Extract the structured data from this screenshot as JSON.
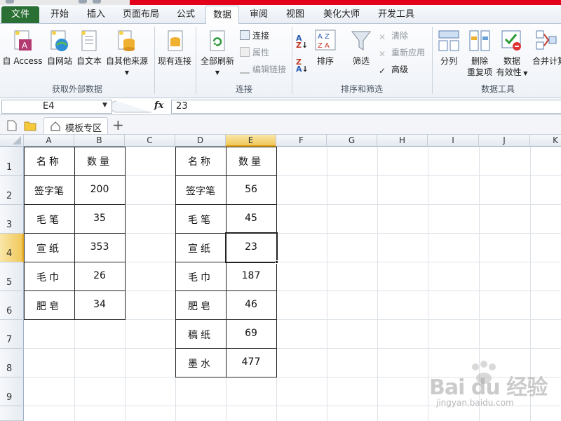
{
  "tabs": [
    {
      "label": "文件",
      "name": "tab-file"
    },
    {
      "label": "开始",
      "name": "tab-home"
    },
    {
      "label": "插入",
      "name": "tab-insert"
    },
    {
      "label": "页面布局",
      "name": "tab-page-layout"
    },
    {
      "label": "公式",
      "name": "tab-formulas"
    },
    {
      "label": "数据",
      "name": "tab-data"
    },
    {
      "label": "审阅",
      "name": "tab-review"
    },
    {
      "label": "视图",
      "name": "tab-view"
    },
    {
      "label": "美化大师",
      "name": "tab-beautify"
    },
    {
      "label": "开发工具",
      "name": "tab-developer"
    }
  ],
  "active_tab": "数据",
  "ribbon": {
    "external": {
      "label": "获取外部数据",
      "access": "自 Access",
      "web": "自网站",
      "text": "自文本",
      "other": "自其他来源",
      "existing": "现有连接"
    },
    "connections": {
      "label": "连接",
      "refresh_all": "全部刷新",
      "connections": "连接",
      "properties": "属性",
      "edit_links": "编辑链接"
    },
    "sort_filter": {
      "label": "排序和筛选",
      "sort": "排序",
      "filter": "筛选",
      "clear": "清除",
      "reapply": "重新应用",
      "advanced": "高级"
    },
    "data_tools": {
      "label": "数据工具",
      "split": "分列",
      "remove_dup_1": "删除",
      "remove_dup_2": "重复项",
      "validation_1": "数据",
      "validation_2": "有效性",
      "consolidate": "合并计算"
    }
  },
  "formula_bar": {
    "name_box": "E4",
    "fx": "fx",
    "value": "23"
  },
  "doc_tab": {
    "label": "模板专区",
    "add": "+"
  },
  "grid": {
    "columns": [
      "A",
      "B",
      "C",
      "D",
      "E",
      "F",
      "G",
      "H",
      "I",
      "J",
      "K"
    ],
    "rows": [
      "1",
      "2",
      "3",
      "4",
      "5",
      "6",
      "7",
      "8",
      "9"
    ],
    "selected_column": "E",
    "selected_row": "4"
  },
  "table1": {
    "header": [
      "名称",
      "数量"
    ],
    "rows": [
      [
        "签字笔",
        "200"
      ],
      [
        "毛笔",
        "35"
      ],
      [
        "宣纸",
        "353"
      ],
      [
        "毛巾",
        "26"
      ],
      [
        "肥皂",
        "34"
      ]
    ]
  },
  "table2": {
    "header": [
      "名称",
      "数量"
    ],
    "rows": [
      [
        "签字笔",
        "56"
      ],
      [
        "毛笔",
        "45"
      ],
      [
        "宣纸",
        "23"
      ],
      [
        "毛巾",
        "187"
      ],
      [
        "肥皂",
        "46"
      ],
      [
        "稿纸",
        "69"
      ],
      [
        "墨水",
        "477"
      ]
    ]
  },
  "watermark": {
    "logo": "Bai du 经验",
    "url": "jingyan.baidu.com"
  },
  "colors": {
    "file_tab": "#2a6f34",
    "title_accent": "#e3001b",
    "selection_header": "#f1c759"
  }
}
